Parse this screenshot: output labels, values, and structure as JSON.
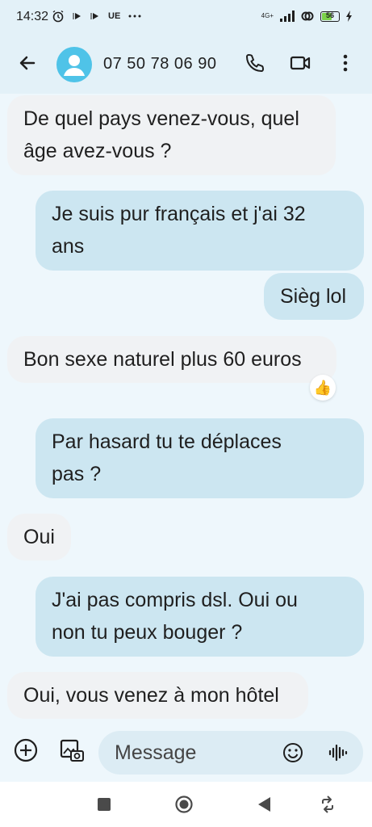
{
  "status_bar": {
    "time": "14:32",
    "carrier_label": "UE",
    "network": "4G+",
    "battery_level": "56",
    "icons": [
      "alarm-icon",
      "play-icon",
      "play-icon",
      "more-dots-icon",
      "signal-icon",
      "link-icon",
      "battery-icon",
      "charging-icon"
    ]
  },
  "header": {
    "contact_name": "07 50 78 06 90",
    "icons": [
      "back-arrow-icon",
      "avatar-icon",
      "phone-icon",
      "video-icon",
      "more-vert-icon"
    ]
  },
  "messages": [
    {
      "direction": "incoming",
      "text": "De quel pays venez-vous, quel\nâge avez-vous ?"
    },
    {
      "direction": "outgoing",
      "text": "Je suis pur français et j'ai 32\nans"
    },
    {
      "direction": "outgoing",
      "text": "Sièg lol"
    },
    {
      "direction": "incoming",
      "text": "Bon sexe naturel plus 60 euros",
      "reaction": "👍"
    },
    {
      "direction": "outgoing",
      "text": "Par hasard tu te déplaces\npas ?"
    },
    {
      "direction": "incoming",
      "text": "Oui"
    },
    {
      "direction": "outgoing",
      "text": "J'ai pas compris dsl. Oui ou\nnon tu peux bouger ?"
    },
    {
      "direction": "incoming",
      "text": "Oui, vous venez à mon hôtel"
    }
  ],
  "composer": {
    "placeholder": "Message",
    "icons": [
      "add-icon",
      "gallery-icon",
      "emoji-icon",
      "voice-icon"
    ]
  },
  "nav_bar": {
    "icons": [
      "recents-icon",
      "home-icon",
      "back-icon",
      "rotate-icon"
    ]
  },
  "colors": {
    "background": "#eef7fc",
    "header": "#e3f1f8",
    "incoming_bubble": "#f0f2f4",
    "outgoing_bubble": "#cce6f1",
    "avatar": "#4fc3e8",
    "battery_fill": "#7cd34a"
  }
}
